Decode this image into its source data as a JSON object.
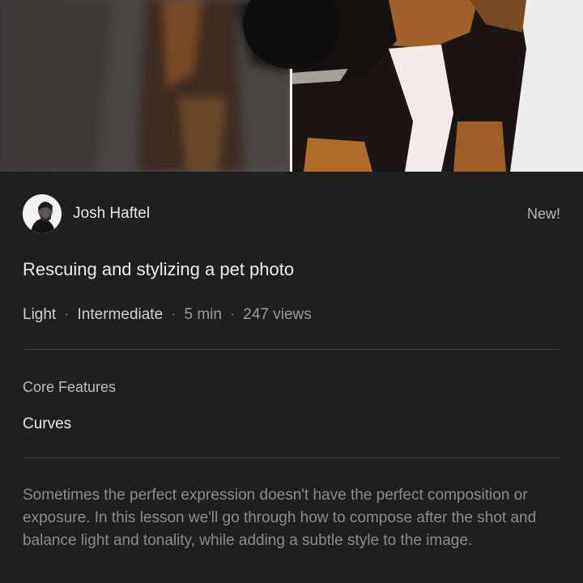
{
  "hero": {
    "image": "before-after comparison of a dog photo",
    "left_label": "before-image",
    "right_label": "after-image"
  },
  "author": {
    "name": "Josh Haftel",
    "avatar": "author-avatar"
  },
  "badge": "New!",
  "lesson": {
    "title": "Rescuing and stylizing a pet photo",
    "meta": {
      "category": "Light",
      "level": "Intermediate",
      "duration": "5 min",
      "views": "247 views",
      "separator": "·"
    }
  },
  "features": {
    "label": "Core Features",
    "value": "Curves"
  },
  "description": "Sometimes the perfect expression doesn't have the perfect composition or exposure. In this lesson we'll go through how to compose after the shot and balance light and tonality, while adding a subtle style to the image."
}
